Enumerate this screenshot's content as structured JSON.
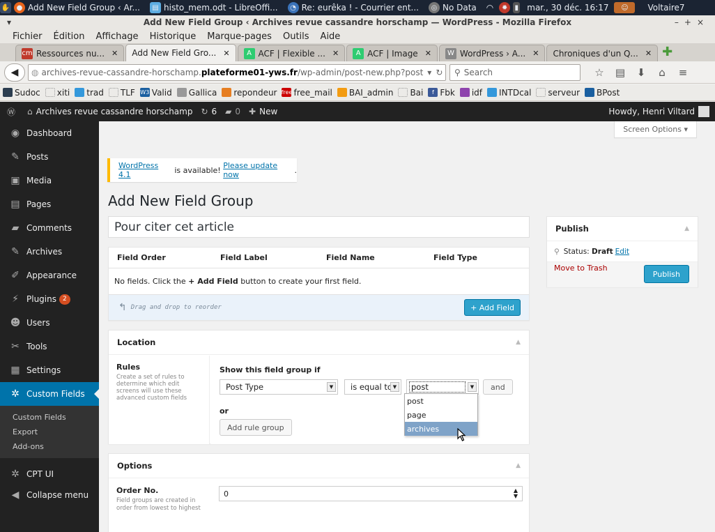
{
  "taskbar": {
    "items": [
      {
        "label": "Add New Field Group ‹ Ar..."
      },
      {
        "label": "histo_mem.odt - LibreOffi..."
      },
      {
        "label": "Re: eurêka ! - Courrier ent..."
      },
      {
        "label": "No Data"
      }
    ],
    "datetime": "mar., 30 déc. 16:17",
    "user": "Voltaire7"
  },
  "window": {
    "title": "Add New Field Group ‹ Archives revue cassandre horschamp — WordPress - Mozilla Firefox"
  },
  "menubar": [
    "Fichier",
    "Édition",
    "Affichage",
    "Historique",
    "Marque-pages",
    "Outils",
    "Aide"
  ],
  "tabs": [
    {
      "label": "Ressources nu...",
      "favicon_text": "cm",
      "color": "#c0392b"
    },
    {
      "label": "Add New Field Gro...",
      "active": true
    },
    {
      "label": "ACF | Flexible ...",
      "favicon_text": "A",
      "color": "#2ecc71"
    },
    {
      "label": "ACF | Image",
      "favicon_text": "A",
      "color": "#2ecc71"
    },
    {
      "label": "WordPress › A...",
      "favicon_text": "W",
      "color": "#888888"
    },
    {
      "label": "Chroniques d'un Q..."
    }
  ],
  "urlbar": {
    "prefix": "archives-revue-cassandre-horschamp.",
    "domain": "plateforme01-yws.fr",
    "path": "/wp-admin/post-new.php?post"
  },
  "search": {
    "placeholder": "Search"
  },
  "bookmarks": [
    {
      "label": "Sudoc",
      "icon_color": "#2c3e50"
    },
    {
      "label": "xiti",
      "empty": true
    },
    {
      "label": "trad",
      "icon_color": "#3498db"
    },
    {
      "label": "TLF",
      "empty": true
    },
    {
      "label": "Valid",
      "icon_color": "#1a5fa0",
      "icon_text": "W3"
    },
    {
      "label": "Gallica",
      "icon_color": "#999999"
    },
    {
      "label": "repondeur",
      "icon_color": "#e67e22"
    },
    {
      "label": "free_mail",
      "icon_color": "#cc0000",
      "icon_text": "free"
    },
    {
      "label": "BAI_admin",
      "icon_color": "#f39c12"
    },
    {
      "label": "Bai",
      "empty": true
    },
    {
      "label": "Fbk",
      "icon_color": "#3b5998",
      "icon_text": "f"
    },
    {
      "label": "idf",
      "icon_color": "#8e44ad"
    },
    {
      "label": "INTDcal",
      "icon_color": "#3498db"
    },
    {
      "label": "serveur",
      "empty": true
    },
    {
      "label": "BPost",
      "icon_color": "#1a5fa0"
    }
  ],
  "adminbar": {
    "site": "Archives revue cassandre horschamp",
    "updates": "6",
    "comments": "0",
    "new": "New",
    "howdy": "Howdy, Henri Viltard"
  },
  "sidebar": {
    "items": [
      {
        "label": "Dashboard",
        "icon": "dashboard-icon",
        "glyph": "◉"
      },
      {
        "label": "Posts",
        "icon": "pin-icon",
        "glyph": "✎"
      },
      {
        "label": "Media",
        "icon": "media-icon",
        "glyph": "▣"
      },
      {
        "label": "Pages",
        "icon": "pages-icon",
        "glyph": "▤"
      },
      {
        "label": "Comments",
        "icon": "comments-icon",
        "glyph": "▰"
      },
      {
        "label": "Archives",
        "icon": "pin-icon",
        "glyph": "✎"
      },
      {
        "label": "Appearance",
        "icon": "brush-icon",
        "glyph": "✐"
      },
      {
        "label": "Plugins",
        "icon": "plugin-icon",
        "glyph": "⚡",
        "badge": "2"
      },
      {
        "label": "Users",
        "icon": "users-icon",
        "glyph": "☻"
      },
      {
        "label": "Tools",
        "icon": "wrench-icon",
        "glyph": "✂"
      },
      {
        "label": "Settings",
        "icon": "settings-icon",
        "glyph": "▦"
      },
      {
        "label": "Custom Fields",
        "icon": "gear-icon",
        "glyph": "✲",
        "current": true
      }
    ],
    "submenu": [
      "Custom Fields",
      "Export",
      "Add-ons"
    ],
    "bottom": [
      {
        "label": "CPT UI",
        "icon": "gear-icon",
        "glyph": "✲"
      },
      {
        "label": "Collapse menu",
        "icon": "collapse-icon",
        "glyph": "◀"
      }
    ]
  },
  "content": {
    "screen_options": "Screen Options ▾",
    "notice": {
      "version_link": "WordPress 4.1",
      "middle": " is available! ",
      "update_link": "Please update now",
      "end": "."
    },
    "page_title": "Add New Field Group",
    "title_value": "Pour citer cet article",
    "fields": {
      "headers": [
        "Field Order",
        "Field Label",
        "Field Name",
        "Field Type"
      ],
      "empty_pre": "No fields. Click the ",
      "empty_bold": "+ Add Field",
      "empty_post": " button to create your first field.",
      "drag_hint": "Drag and drop to reorder",
      "add_button": "+ Add Field"
    },
    "location": {
      "title": "Location",
      "rules_label": "Rules",
      "rules_desc": "Create a set of rules to determine which edit screens will use these advanced custom fields",
      "show_if": "Show this field group if",
      "param": "Post Type",
      "operator": "is equal to",
      "value": "post",
      "and": "and",
      "or": "or",
      "add_group": "Add rule group",
      "options": [
        "post",
        "page",
        "archives"
      ]
    },
    "publish": {
      "title": "Publish",
      "status_label": "Status: ",
      "status_value": "Draft",
      "edit": "Edit",
      "trash": "Move to Trash",
      "publish": "Publish"
    },
    "options": {
      "title": "Options",
      "order_label": "Order No.",
      "order_desc": "Field groups are created in order from lowest to highest",
      "order_value": "0"
    }
  }
}
